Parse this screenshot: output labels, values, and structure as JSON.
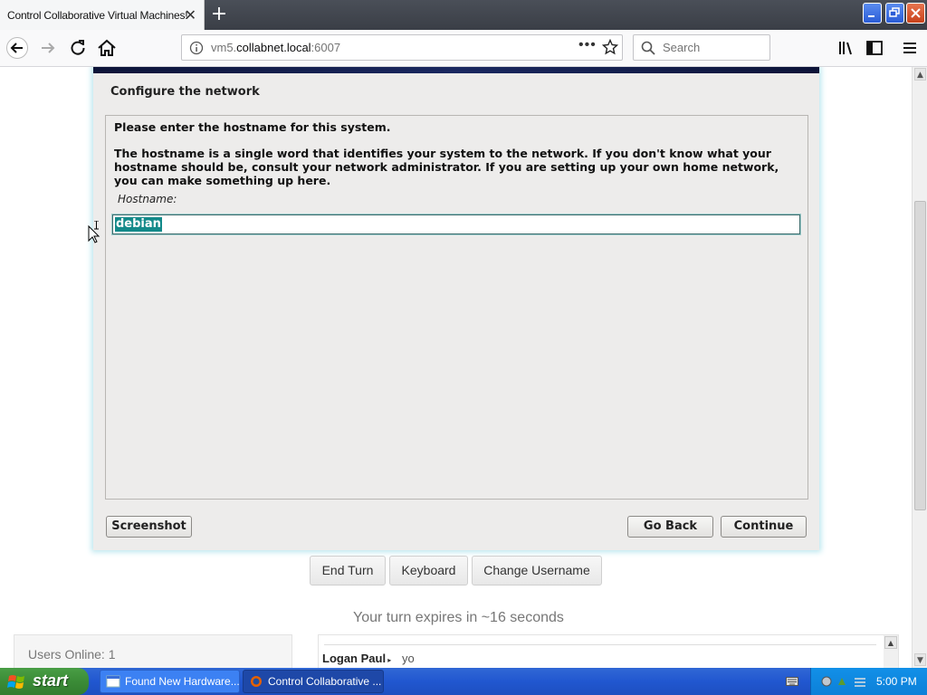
{
  "browser": {
    "tab_title": "Control Collaborative Virtual Machines!",
    "tab_close": "✕",
    "new_tab": "+",
    "url_scheme_host": "vm5.",
    "url_host": "collabnet.local",
    "url_port": ":6007",
    "url_more": "•••",
    "search_placeholder": "Search"
  },
  "installer": {
    "heading": "Configure the network",
    "prompt": "Please enter the hostname for this system.",
    "description": "The hostname is a single word that identifies your system to the network. If you don't know what your hostname should be, consult your network administrator. If you are setting up your own home network, you can make something up here.",
    "field_label": "Hostname:",
    "field_value": "debian",
    "screenshot_button": "Screenshot",
    "go_back_button": "Go Back",
    "continue_button": "Continue"
  },
  "controls": {
    "end_turn": "End Turn",
    "keyboard": "Keyboard",
    "change_username": "Change Username",
    "turn_status": "Your turn expires in ~16 seconds"
  },
  "users": {
    "online_text": "Users Online: 1"
  },
  "chat": {
    "messages": [
      {
        "user": "Logan Paul",
        "text": "yo"
      }
    ]
  },
  "taskbar": {
    "start_label": "start",
    "tasks": [
      {
        "label": "Found New Hardware..."
      },
      {
        "label": "Control Collaborative ..."
      }
    ],
    "clock": "5:00 PM"
  },
  "colors": {
    "selection": "#148a8a",
    "taskbar": "#2157d0",
    "start_button": "#3b8c37"
  }
}
